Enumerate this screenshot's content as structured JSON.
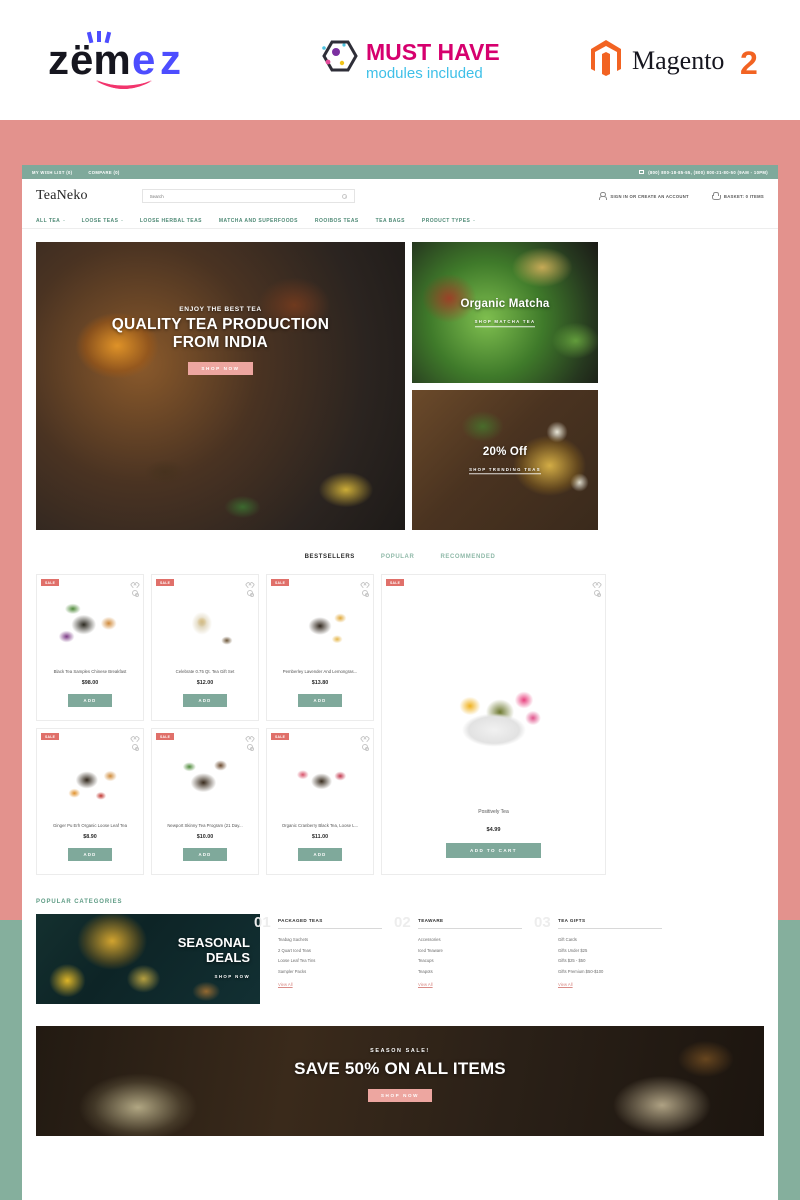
{
  "promo": {
    "zemez": "zemez",
    "must_have": "MUST HAVE",
    "modules_included": "modules included",
    "magento": "Magento",
    "magento_version": "2"
  },
  "topbar": {
    "wishlist": "MY WISH LIST (0)",
    "compare": "COMPARE (0)",
    "phones": "(800) 800-18-85-55, (800) 800-21-80-50 (9AM - 10PM)"
  },
  "header": {
    "brand": "TeaNeko",
    "search_placeholder": "Search",
    "account": "SIGN IN OR CREATE AN ACCOUNT",
    "basket": "BASKET: 0 ITEMS"
  },
  "nav": [
    {
      "label": "ALL TEA",
      "caret": true
    },
    {
      "label": "LOOSE TEAS",
      "caret": true
    },
    {
      "label": "LOOSE HERBAL TEAS",
      "caret": false
    },
    {
      "label": "MATCHA AND SUPERFOODS",
      "caret": false
    },
    {
      "label": "ROOIBOS TEAS",
      "caret": false
    },
    {
      "label": "TEA BAGS",
      "caret": false
    },
    {
      "label": "PRODUCT TYPES",
      "caret": true
    }
  ],
  "hero": {
    "kicker": "ENJOY THE BEST TEA",
    "title_line1": "QUALITY TEA PRODUCTION",
    "title_line2": "FROM INDIA",
    "button": "SHOP NOW"
  },
  "side_banners": [
    {
      "title": "Organic Matcha",
      "link": "SHOP MATCHA TEA"
    },
    {
      "title": "20% Off",
      "link": "SHOP TRENDING TEAS"
    }
  ],
  "tabs": [
    {
      "label": "BESTSELLERS",
      "active": true
    },
    {
      "label": "POPULAR",
      "active": false
    },
    {
      "label": "RECOMMENDED",
      "active": false
    }
  ],
  "badges": {
    "sale": "SALE",
    "add": "ADD",
    "add_to_cart": "ADD TO CART"
  },
  "products": [
    {
      "name": "Black Tea Samples Chinese Breakfast",
      "price": "$98.00",
      "sale": "SALE",
      "add": "ADD"
    },
    {
      "name": "Celebrate 0.75 Qt. Tea Gift Set",
      "price": "$12.00",
      "sale": "SALE",
      "add": "ADD"
    },
    {
      "name": "Pemberley Lavender And Lemongras...",
      "price": "$13.80",
      "sale": "SALE",
      "add": "ADD"
    },
    {
      "name": "Ginger Pu Erh Organic Loose Leaf Tea",
      "price": "$8.90",
      "sale": "SALE",
      "add": "ADD"
    },
    {
      "name": "Newport Skinny Tea Program (21 Day...",
      "price": "$10.00",
      "sale": "SALE",
      "add": "ADD"
    },
    {
      "name": "Organic Cranberry Black Tea, Loose L...",
      "price": "$11.00",
      "sale": "SALE",
      "add": "ADD"
    }
  ],
  "featured": {
    "name": "Positively Tea",
    "price": "$4.99",
    "sale": "SALE",
    "button": "ADD TO CART"
  },
  "popular_categories": {
    "title": "POPULAR CATEGORIES",
    "banner": {
      "title_line1": "SEASONAL",
      "title_line2": "DEALS",
      "link": "SHOP NOW"
    },
    "columns": [
      {
        "number": "01",
        "heading": "PACKAGED TEAS",
        "items": [
          "Teabag Sachets",
          "2 Quart Iced Teas",
          "Loose Leaf Tea Tins",
          "Sampler Packs"
        ],
        "view_all": "View All"
      },
      {
        "number": "02",
        "heading": "TEAWARE",
        "items": [
          "Accessories",
          "Iced Teaware",
          "Teacups",
          "Teapots"
        ],
        "view_all": "View All"
      },
      {
        "number": "03",
        "heading": "TEA GIFTS",
        "items": [
          "Gift Cards",
          "Gifts Under $25",
          "Gifts $25 - $50",
          "Gifts Premium $50-$100"
        ],
        "view_all": "View All"
      }
    ]
  },
  "season_banner": {
    "kicker": "SEASON  SALE!",
    "title": "SAVE 50% ON ALL ITEMS",
    "button": "SHOP NOW"
  },
  "colors": {
    "salmon": "#e3928d",
    "sage": "#85af9d",
    "teal": "#7fa99b",
    "sale_red": "#e0706a",
    "pink_button": "#eda6a0",
    "nav_green": "#4f8a76"
  }
}
